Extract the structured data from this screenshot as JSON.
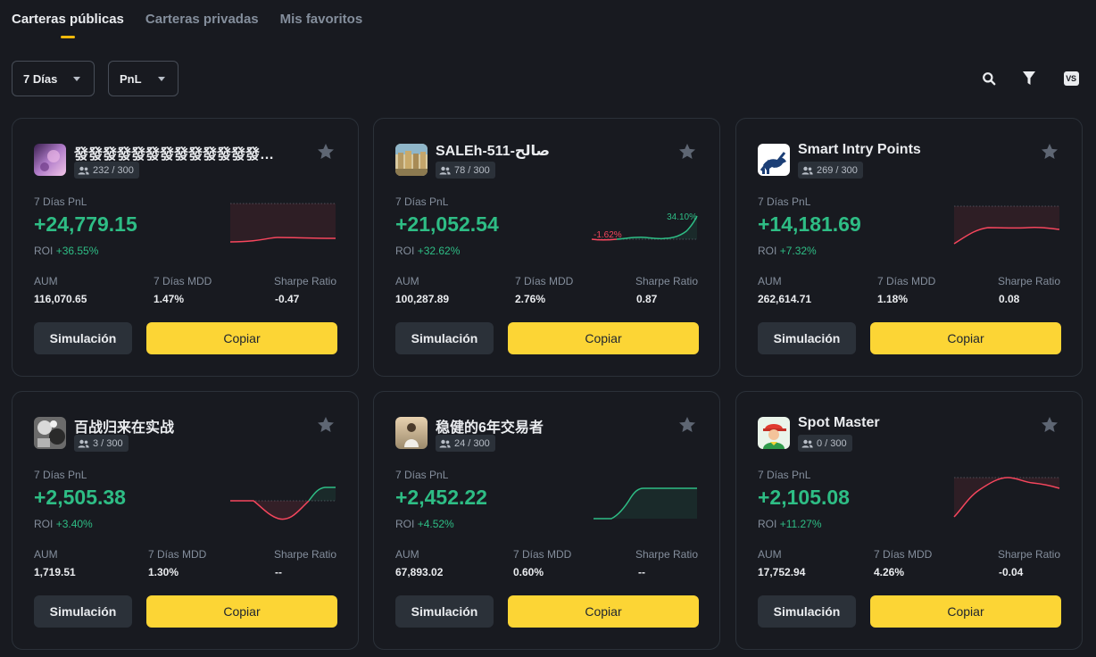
{
  "tabs": [
    {
      "label": "Carteras públicas",
      "active": true
    },
    {
      "label": "Carteras privadas",
      "active": false
    },
    {
      "label": "Mis favoritos",
      "active": false
    }
  ],
  "filters": {
    "period": "7 Días",
    "metric": "PnL"
  },
  "toolbar": {
    "search_icon": "search-icon",
    "filter_icon": "funnel-icon",
    "compare_label": "VS"
  },
  "colors": {
    "accent": "#fcd535",
    "positive": "#2ebd85",
    "negative": "#f6465d",
    "card_border": "#2b3139",
    "background": "#181a20"
  },
  "common": {
    "pnl_label": "7 Días PnL",
    "roi_prefix": "ROI",
    "aum_label": "AUM",
    "mdd_label": "7 Días MDD",
    "sharpe_label": "Sharpe Ratio",
    "simulate_label": "Simulación",
    "copy_label": "Copiar"
  },
  "cards": [
    {
      "name": "發發發發發發發發發發發發發發發發",
      "copiers": "232 / 300",
      "pnl": "+24,779.15",
      "roi": "+36.55%",
      "aum": "116,070.65",
      "mdd": "1.47%",
      "sharpe": "-0.47",
      "chart_labels": {
        "low": "",
        "high": ""
      }
    },
    {
      "name": "SALEh-511-صالح",
      "copiers": "78 / 300",
      "pnl": "+21,052.54",
      "roi": "+32.62%",
      "aum": "100,287.89",
      "mdd": "2.76%",
      "sharpe": "0.87",
      "chart_labels": {
        "low": "-1.62%",
        "high": "34.10%"
      }
    },
    {
      "name": "Smart Intry Points",
      "copiers": "269 / 300",
      "pnl": "+14,181.69",
      "roi": "+7.32%",
      "aum": "262,614.71",
      "mdd": "1.18%",
      "sharpe": "0.08",
      "chart_labels": {
        "low": "",
        "high": ""
      }
    },
    {
      "name": "百战归来在实战",
      "copiers": "3 / 300",
      "pnl": "+2,505.38",
      "roi": "+3.40%",
      "aum": "1,719.51",
      "mdd": "1.30%",
      "sharpe": "--",
      "chart_labels": {
        "low": "",
        "high": ""
      }
    },
    {
      "name": "稳健的6年交易者",
      "copiers": "24 / 300",
      "pnl": "+2,452.22",
      "roi": "+4.52%",
      "aum": "67,893.02",
      "mdd": "0.60%",
      "sharpe": "--",
      "chart_labels": {
        "low": "",
        "high": ""
      }
    },
    {
      "name": "Spot Master",
      "copiers": "0 / 300",
      "pnl": "+2,105.08",
      "roi": "+11.27%",
      "aum": "17,752.94",
      "mdd": "4.26%",
      "sharpe": "-0.04",
      "chart_labels": {
        "low": "",
        "high": ""
      }
    }
  ]
}
